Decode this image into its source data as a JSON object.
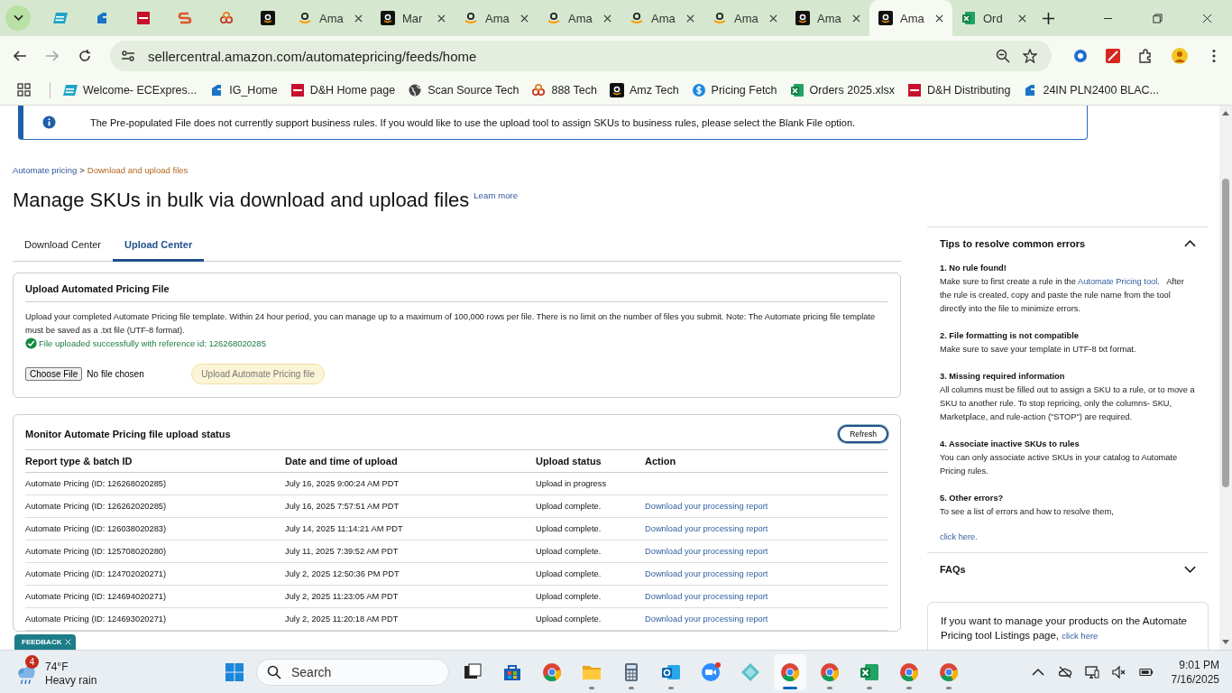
{
  "browser": {
    "tabs": [
      {
        "kind": "ec",
        "selected": false
      },
      {
        "kind": "ig",
        "selected": false
      },
      {
        "kind": "dh",
        "selected": false
      },
      {
        "kind": "s",
        "selected": false
      },
      {
        "kind": "rings",
        "selected": false
      },
      {
        "kind": "amazon",
        "selected": false
      },
      {
        "kind": "smile",
        "title": "Ama",
        "selected": false
      },
      {
        "kind": "amazon",
        "title": "Mar",
        "selected": false
      },
      {
        "kind": "smile",
        "title": "Ama",
        "selected": false
      },
      {
        "kind": "smile",
        "title": "Ama",
        "selected": false
      },
      {
        "kind": "smile",
        "title": "Ama",
        "selected": false
      },
      {
        "kind": "smile",
        "title": "Ama",
        "selected": false
      },
      {
        "kind": "amazon",
        "title": "Ama",
        "selected": false
      },
      {
        "kind": "amazon",
        "title": "Ama",
        "selected": true
      },
      {
        "kind": "excel",
        "title": "Ord",
        "selected": false
      }
    ],
    "address": "sellercentral.amazon.com/automatepricing/feeds/home",
    "bookmarks": [
      {
        "kind": "ec",
        "label": "Welcome- ECExpres..."
      },
      {
        "kind": "ig",
        "label": "IG_Home"
      },
      {
        "kind": "dh",
        "label": "D&H Home page"
      },
      {
        "kind": "globe",
        "label": "Scan Source Tech"
      },
      {
        "kind": "rings",
        "label": "888 Tech"
      },
      {
        "kind": "amazon",
        "label": "Amz Tech"
      },
      {
        "kind": "pricing",
        "label": "Pricing Fetch"
      },
      {
        "kind": "excel",
        "label": "Orders 2025.xlsx"
      },
      {
        "kind": "dh",
        "label": "D&H Distributing"
      },
      {
        "kind": "ig",
        "label": "24IN PLN2400 BLAC..."
      }
    ]
  },
  "page": {
    "banner": "The Pre-populated File does not currently support business rules. If you would like to use the upload tool to assign SKUs to business rules, please select the Blank File option.",
    "breadcrumb_separator": ">",
    "breadcrumb": [
      {
        "label": "Automate pricing",
        "current": false
      },
      {
        "label": "Download and upload files",
        "current": true
      }
    ],
    "title": "Manage SKUs in bulk via download and upload files",
    "learn_more": "Learn more",
    "tabs": [
      {
        "label": "Download Center",
        "selected": false
      },
      {
        "label": "Upload Center",
        "selected": true
      }
    ],
    "upload_card": {
      "title": "Upload Automated Pricing File",
      "description": "Upload your completed Automate Pricing file template. Within 24 hour period, you can manage up to a maximum of 100,000 rows per file. There is no limit on the number of files you submit. Note: The Automate pricing file template must be saved as a .txt file (UTF-8 format).",
      "success": "File uploaded successfully with reference id: 126268020285",
      "choose_file": "Choose File",
      "file_status": "No file chosen",
      "upload_button": {
        "label": "Upload Automate Pricing file",
        "disabled": true
      }
    },
    "monitor": {
      "title": "Monitor Automate Pricing file upload status",
      "refresh": "Refresh",
      "columns": [
        "Report type & batch ID",
        "Date and time of upload",
        "Upload status",
        "Action"
      ],
      "rows": [
        {
          "report": "Automate Pricing (ID: 126268020285)",
          "date": "July 16, 2025 9:00:24 AM PDT",
          "status": "Upload in progress"
        },
        {
          "report": "Automate Pricing (ID: 126262020285)",
          "date": "July 16, 2025 7:57:51 AM PDT",
          "status": "Upload complete.",
          "action": "Download your processing report"
        },
        {
          "report": "Automate Pricing (ID: 126038020283)",
          "date": "July 14, 2025 11:14:21 AM PDT",
          "status": "Upload complete.",
          "action": "Download your processing report"
        },
        {
          "report": "Automate Pricing (ID: 125708020280)",
          "date": "July 11, 2025 7:39:52 AM PDT",
          "status": "Upload complete.",
          "action": "Download your processing report"
        },
        {
          "report": "Automate Pricing (ID: 124702020271)",
          "date": "July 2, 2025 12:50:36 PM PDT",
          "status": "Upload complete.",
          "action": "Download your processing report"
        },
        {
          "report": "Automate Pricing (ID: 124694020271)",
          "date": "July 2, 2025 11:23:05 AM PDT",
          "status": "Upload complete.",
          "action": "Download your processing report"
        },
        {
          "report": "Automate Pricing (ID: 124693020271)",
          "date": "July 2, 2025 11:20:18 AM PDT",
          "status": "Upload complete.",
          "action": "Download your processing report"
        }
      ]
    },
    "feedback": "FEEDBACK",
    "sidebar": {
      "sections": [
        {
          "title": "Tips to resolve common errors",
          "expanded": true,
          "tips": [
            {
              "heading": "1. No rule found!",
              "text": "Make sure to first create a rule in the",
              "link": "Automate Pricing tool.",
              "after": "After the rule is created, copy and paste the rule name from the tool directly into the file to minimize errors."
            },
            {
              "heading": "2. File formatting is not compatible",
              "text": "Make sure to save your template in UTF-8 txt format."
            },
            {
              "heading": "3. Missing required information",
              "text": "All columns must be filled out to assign a SKU to a rule, or to move a SKU to another rule. To stop repricing, only the columns- SKU, Marketplace, and rule-action (\"STOP\") are required."
            },
            {
              "heading": "4. Associate inactive SKUs to rules",
              "text": "You can only associate active SKUs in your catalog to Automate Pricing rules."
            },
            {
              "heading": "5. Other errors?",
              "text": "To see a list of errors and how to resolve them,"
            }
          ],
          "footer_link": "click here."
        },
        {
          "title": "FAQs",
          "expanded": false
        }
      ],
      "listings_card": {
        "text": "If you want to manage your products on the Automate Pricing tool Listings page,",
        "link": "click here"
      }
    }
  },
  "taskbar": {
    "weather": {
      "badge": "4",
      "temp": "74°F",
      "condition": "Heavy rain"
    },
    "search": {
      "placeholder": "Search"
    },
    "apps": [
      {
        "kind": "taskview",
        "running": false,
        "selected": false
      },
      {
        "kind": "store",
        "running": false,
        "selected": false
      },
      {
        "kind": "chrome",
        "running": false,
        "selected": false
      },
      {
        "kind": "folder",
        "running": true,
        "selected": false
      },
      {
        "kind": "calculator",
        "running": true,
        "selected": false
      },
      {
        "kind": "outlook",
        "running": true,
        "selected": false
      },
      {
        "kind": "zoom",
        "running": false,
        "selected": false
      },
      {
        "kind": "diamond",
        "running": false,
        "selected": false
      },
      {
        "kind": "chrome",
        "running": true,
        "selected": true
      },
      {
        "kind": "chrome",
        "running": true,
        "selected": false
      },
      {
        "kind": "excel",
        "running": true,
        "selected": false
      },
      {
        "kind": "chrome",
        "running": true,
        "selected": false
      },
      {
        "kind": "chrome",
        "running": true,
        "selected": false
      }
    ],
    "time": "9:01 PM",
    "date": "7/16/2025"
  }
}
